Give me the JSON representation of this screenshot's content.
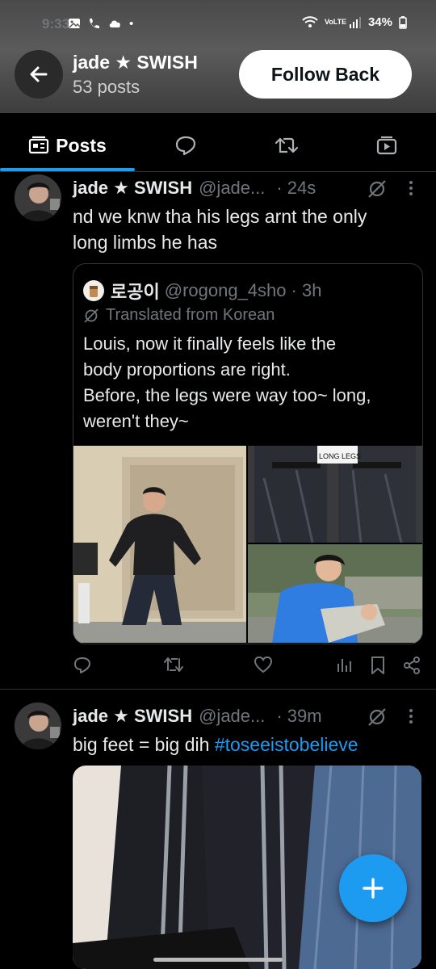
{
  "status_bar": {
    "time": "9:33",
    "battery": "34%",
    "network": "VoLTE"
  },
  "header": {
    "name": "jade ★ SWISH",
    "posts_count": "53 posts",
    "follow_label": "Follow Back"
  },
  "tabs": [
    {
      "label": "Posts",
      "icon": "posts-icon",
      "active": true
    },
    {
      "label": "",
      "icon": "replies-icon"
    },
    {
      "label": "",
      "icon": "reposts-icon"
    },
    {
      "label": "",
      "icon": "media-icon"
    }
  ],
  "posts": [
    {
      "name": "jade ★ SWISH",
      "handle": "@jade...",
      "time": "· 24s",
      "text_lines": [
        "nd we knw tha his legs arnt the only",
        "long limbs he has"
      ],
      "quote": {
        "name": "로공이",
        "handle": "@rogong_4sho",
        "time": "· 3h",
        "translated_label": "Translated from Korean",
        "text_lines": [
          "Louis, now it finally feels like the",
          "body proportions are right.",
          "Before, the legs were way too~ long,",
          "weren't they~"
        ],
        "image_caption": "LONG LEGS"
      }
    },
    {
      "name": "jade ★ SWISH",
      "handle": "@jade...",
      "time": "· 39m",
      "text_plain": "big feet = big dih ",
      "hashtag": "#toseeistobelieve"
    }
  ],
  "colors": {
    "accent": "#1d9bf0",
    "background": "#000000",
    "muted": "#71767b"
  }
}
